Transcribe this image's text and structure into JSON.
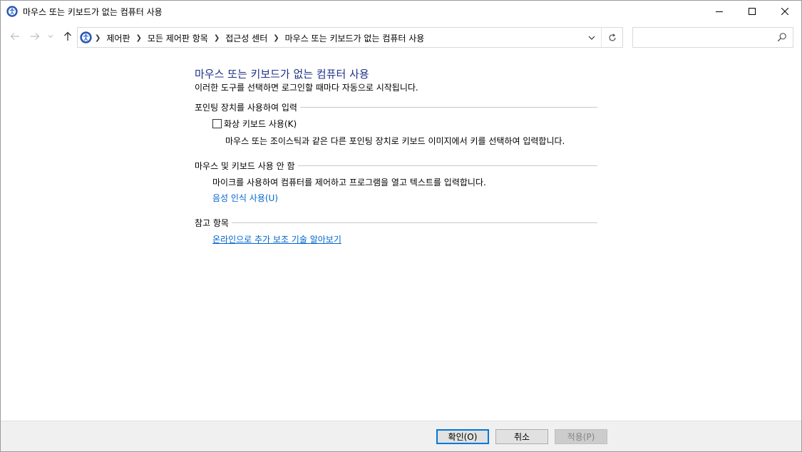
{
  "window": {
    "title": "마우스 또는 키보드가 없는 컴퓨터 사용"
  },
  "address": {
    "breadcrumbs": [
      "제어판",
      "모든 제어판 항목",
      "접근성 센터",
      "마우스 또는 키보드가 없는 컴퓨터 사용"
    ]
  },
  "search": {
    "placeholder": "",
    "value": ""
  },
  "main": {
    "title": "마우스 또는 키보드가 없는 컴퓨터 사용",
    "subtitle": "이러한 도구를 선택하면 로그인할 때마다 자동으로 시작됩니다.",
    "section_pointing": {
      "header": "포인팅 장치를 사용하여 입력",
      "checkbox_label": "화상 키보드 사용(K)",
      "checkbox_checked": false,
      "description": "마우스 또는 조이스틱과 같은 다른 포인팅 장치로 키보드 이미지에서 키를 선택하여 입력합니다."
    },
    "section_no_input": {
      "header": "마우스 및 키보드 사용 안 함",
      "description": "마이크를 사용하여 컴퓨터를 제어하고 프로그램을 열고 텍스트를 입력합니다.",
      "link": "음성 인식 사용(U)"
    },
    "section_see_also": {
      "header": "참고 항목",
      "link": "온라인으로 추가 보조 기술 알아보기"
    }
  },
  "footer": {
    "ok_label": "확인(O)",
    "cancel_label": "취소",
    "apply_label": "적용(P)"
  },
  "colors": {
    "title_blue": "#1e3287",
    "link_blue": "#0066cc",
    "footer_bg": "#f0f0f0",
    "focus_blue": "#0078d7"
  }
}
